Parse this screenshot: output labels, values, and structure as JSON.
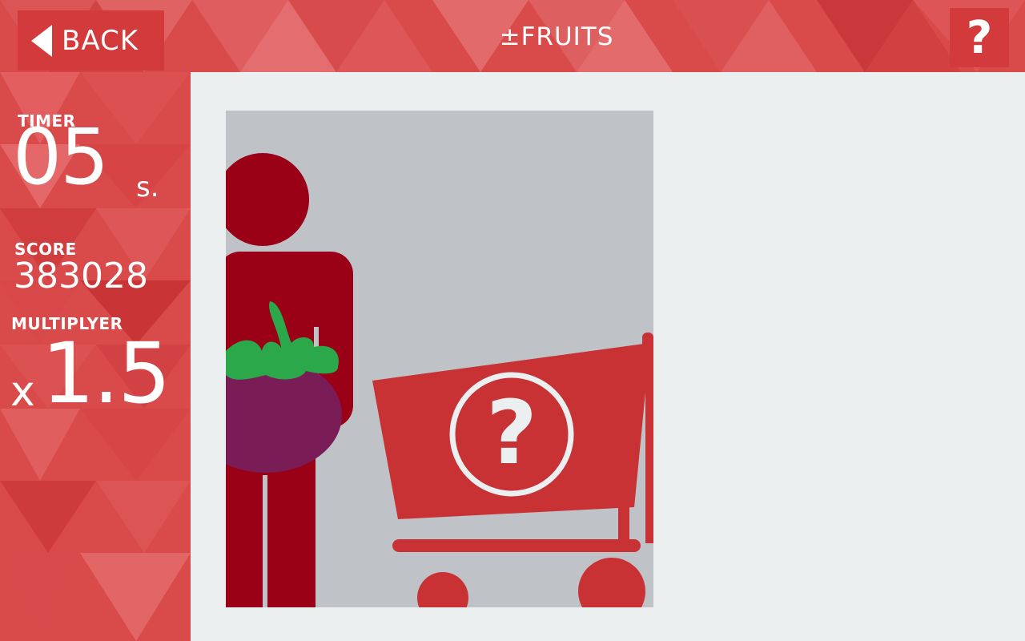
{
  "header": {
    "back_label": "BACK",
    "title": "±FRUITS",
    "help_label": "?"
  },
  "stats": {
    "timer_label": "TIMER",
    "timer_value": "05",
    "timer_unit": "s.",
    "score_label": "SCORE",
    "score_value": "383028",
    "multiplier_label": "MULTIPLYER",
    "multiplier_prefix": "x",
    "multiplier_value": "1.5"
  },
  "puzzle": {
    "image_subject": "person-holding-mangosteen-with-mystery-cart",
    "icons": [
      "back-arrow-icon",
      "help-icon",
      "question-mark-icon",
      "shopping-cart-icon",
      "person-icon",
      "mangosteen-icon"
    ]
  },
  "colors": {
    "primary_red": "#d33a3b",
    "dark_red": "#9a0016",
    "cart_red": "#c83234",
    "panel_gray": "#bfc3c7",
    "background": "#eceff0",
    "fruit_purple": "#7a1d56",
    "leaf_green": "#2aa84a"
  }
}
